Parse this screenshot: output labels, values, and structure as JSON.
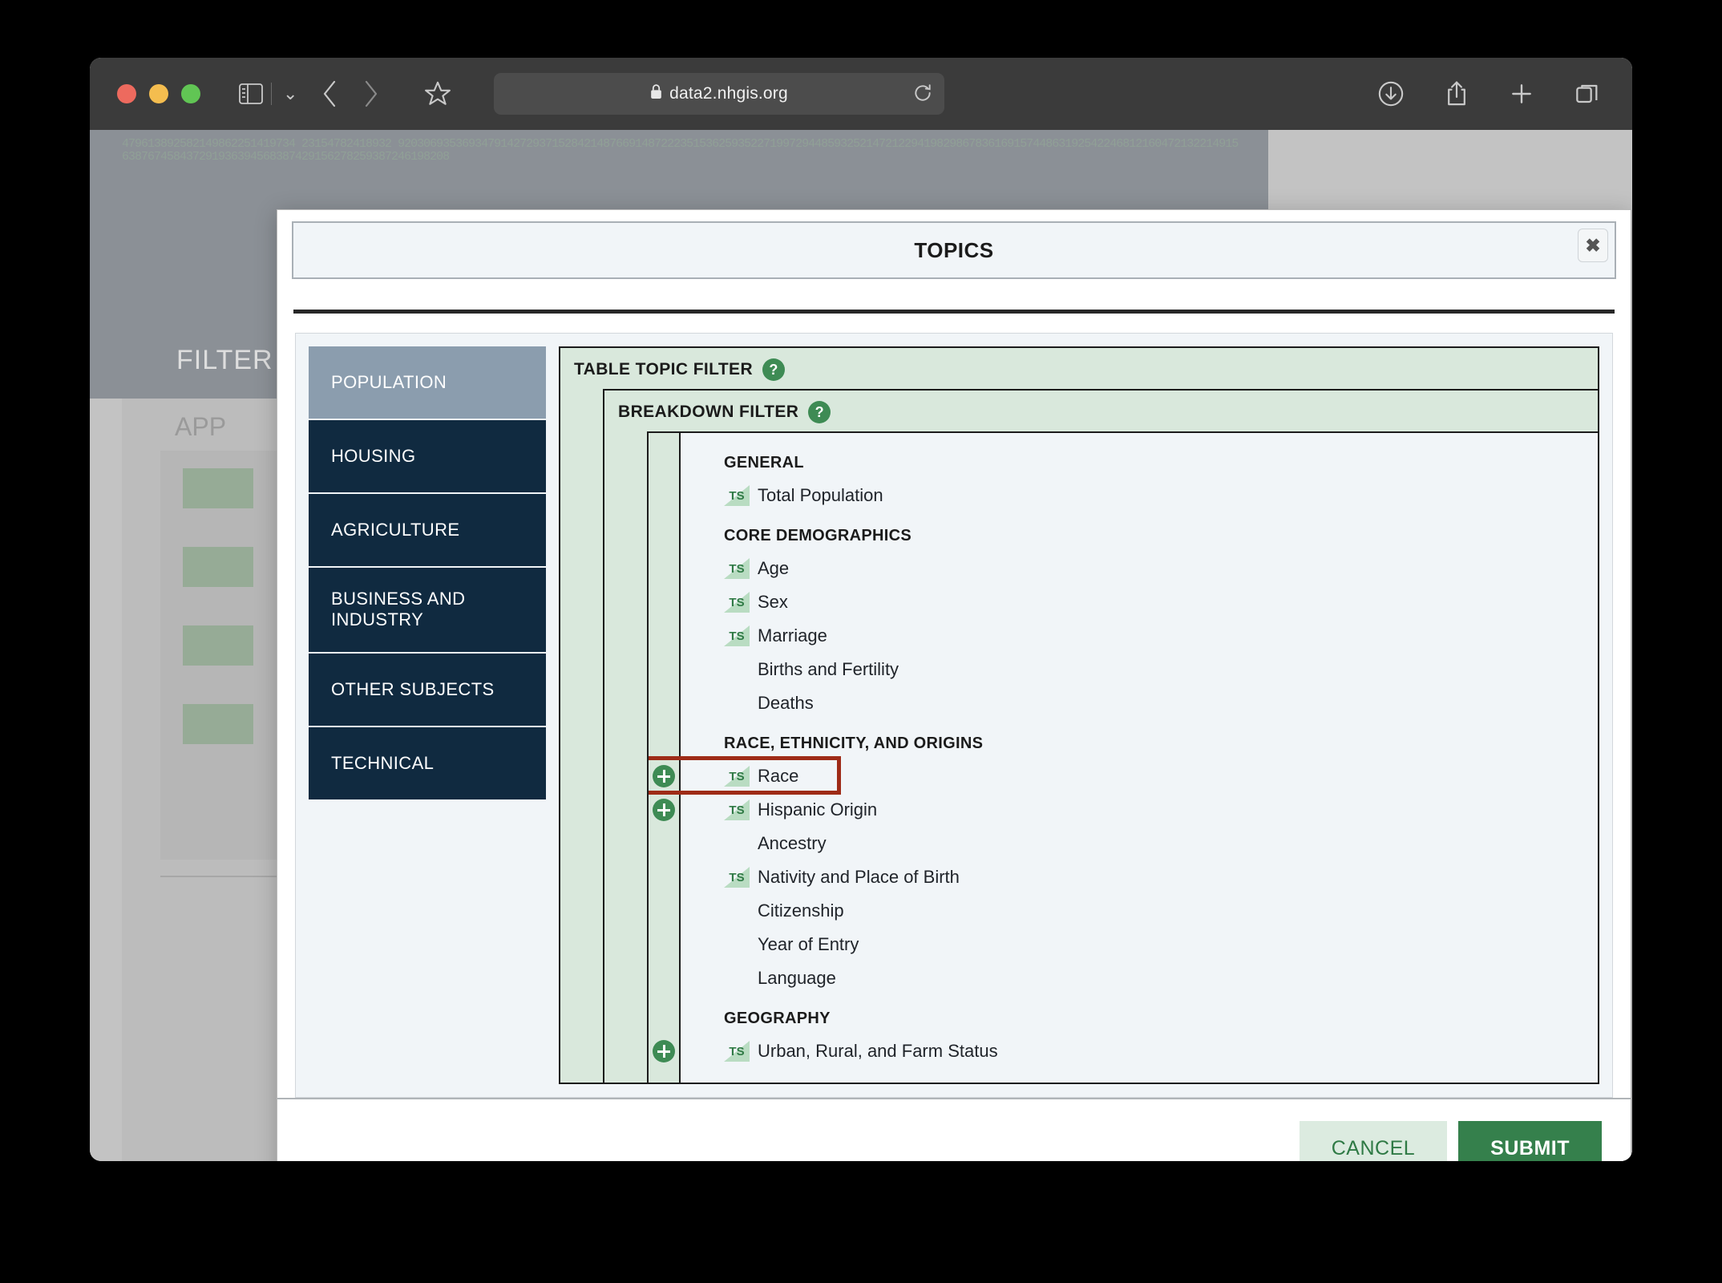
{
  "browser": {
    "url": "data2.nhgis.org",
    "icons": {
      "sidebar_toggle": "sidebar-toggle-icon",
      "chevron_down": "chevron-down-icon",
      "back": "back-arrow-icon",
      "forward": "forward-arrow-icon",
      "bookmark": "star-icon",
      "lock": "lock-icon",
      "reload": "reload-icon",
      "downloads": "downloads-icon",
      "share": "share-icon",
      "new_tab": "plus-icon",
      "tab_overview": "tab-overview-icon"
    }
  },
  "background_page": {
    "filter_label": "FILTER",
    "app_label": "APP",
    "digits": "479613892582149862251419734 23154782418932 92030693536934791427293715284214876691487222351536259352271997294485932521472122941982986783616915744863192542246812160472132214915638767458437291936394568387429156278259387246198208"
  },
  "modal": {
    "title": "TOPICS",
    "close_label": "✖",
    "footer": {
      "cancel_label": "CANCEL",
      "submit_label": "SUBMIT"
    }
  },
  "sidebar": {
    "items": [
      {
        "label": "POPULATION",
        "selected": true
      },
      {
        "label": "HOUSING",
        "selected": false
      },
      {
        "label": "AGRICULTURE",
        "selected": false
      },
      {
        "label": "BUSINESS AND INDUSTRY",
        "selected": false
      },
      {
        "label": "OTHER SUBJECTS",
        "selected": false
      },
      {
        "label": "TECHNICAL",
        "selected": false
      }
    ]
  },
  "filters": {
    "table_topic_filter_label": "TABLE TOPIC FILTER",
    "breakdown_filter_label": "BREAKDOWN FILTER",
    "help_label": "?"
  },
  "topics": {
    "sections": [
      {
        "heading": "GENERAL",
        "rows": [
          {
            "label": "Total Population",
            "ts": true,
            "topic_add": true,
            "breakdown_add": false,
            "checked": false,
            "highlighted": false
          }
        ]
      },
      {
        "heading": "CORE DEMOGRAPHICS",
        "rows": [
          {
            "label": "Age",
            "ts": true,
            "topic_add": true,
            "breakdown_add": false,
            "checked": false,
            "highlighted": false
          },
          {
            "label": "Sex",
            "ts": true,
            "topic_add": true,
            "breakdown_add": false,
            "checked": false,
            "highlighted": false
          },
          {
            "label": "Marriage",
            "ts": true,
            "topic_add": true,
            "breakdown_add": false,
            "checked": false,
            "highlighted": false
          },
          {
            "label": "Births and Fertility",
            "ts": false,
            "topic_add": true,
            "breakdown_add": false,
            "checked": false,
            "highlighted": false
          },
          {
            "label": "Deaths",
            "ts": false,
            "topic_add": true,
            "breakdown_add": false,
            "checked": false,
            "highlighted": false
          }
        ]
      },
      {
        "heading": "RACE, ETHNICITY, AND ORIGINS",
        "rows": [
          {
            "label": "Race",
            "ts": true,
            "topic_add": false,
            "breakdown_add": true,
            "checked": true,
            "highlighted": true
          },
          {
            "label": "Hispanic Origin",
            "ts": true,
            "topic_add": true,
            "breakdown_add": true,
            "checked": false,
            "highlighted": false
          },
          {
            "label": "Ancestry",
            "ts": false,
            "topic_add": true,
            "breakdown_add": false,
            "checked": false,
            "highlighted": false
          },
          {
            "label": "Nativity and Place of Birth",
            "ts": true,
            "topic_add": true,
            "breakdown_add": false,
            "checked": false,
            "highlighted": false
          },
          {
            "label": "Citizenship",
            "ts": false,
            "topic_add": true,
            "breakdown_add": false,
            "checked": false,
            "highlighted": false
          },
          {
            "label": "Year of Entry",
            "ts": false,
            "topic_add": true,
            "breakdown_add": false,
            "checked": false,
            "highlighted": false
          },
          {
            "label": "Language",
            "ts": false,
            "topic_add": true,
            "breakdown_add": false,
            "checked": false,
            "highlighted": false
          }
        ]
      },
      {
        "heading": "GEOGRAPHY",
        "rows": [
          {
            "label": "Urban, Rural, and Farm Status",
            "ts": true,
            "topic_add": true,
            "breakdown_add": true,
            "checked": false,
            "highlighted": false
          }
        ]
      }
    ]
  },
  "colors": {
    "accent_green": "#3e8b54",
    "submit_green": "#35804c",
    "panel_green": "#d9e8dc",
    "sidebar_navy": "#102a40",
    "sidebar_selected": "#8b9dae",
    "highlight_red": "#9e2b17"
  }
}
